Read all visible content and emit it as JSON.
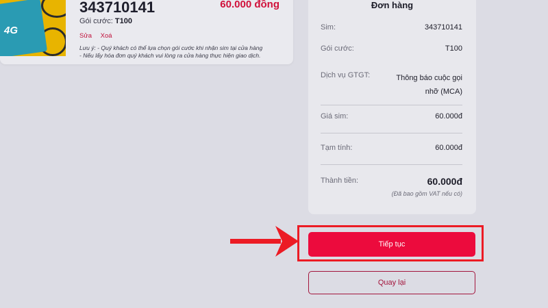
{
  "sim_card": {
    "number": "343710141",
    "price": "60.000 đồng",
    "plan_label": "Gói cước:",
    "plan_value": "T100",
    "edit_label": "Sửa",
    "delete_label": "Xoá",
    "note_line1": "Lưu ý: - Quý khách có thể lựa chọn gói cước khi nhận sim tại cửa hàng",
    "note_line2": "- Nếu lấy hóa đơn quý khách vui lòng ra cửa hàng thực hiện giao dịch.",
    "image_badge": "4G"
  },
  "order": {
    "title": "Đơn hàng",
    "sim_label": "Sim:",
    "sim_value": "343710141",
    "plan_label": "Gói cước:",
    "plan_value": "T100",
    "vas_label": "Dịch vụ GTGT:",
    "vas_value_line1": "Thông báo cuộc gọi",
    "vas_value_line2": "nhỡ (MCA)",
    "sim_price_label": "Giá sim:",
    "sim_price_value": "60.000đ",
    "subtotal_label": "Tạm tính:",
    "subtotal_value": "60.000đ",
    "total_label": "Thành tiền:",
    "total_value": "60.000đ",
    "vat_note": "(Đã bao gồm VAT nếu có)"
  },
  "buttons": {
    "continue_label": "Tiếp tục",
    "back_label": "Quay lại"
  },
  "colors": {
    "accent": "#ec0b3d",
    "annotation": "#ec1b24",
    "price": "#d0103a"
  }
}
